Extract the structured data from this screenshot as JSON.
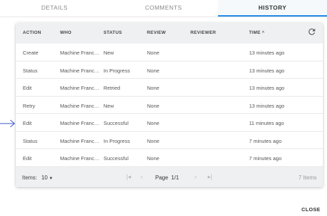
{
  "tabs": [
    {
      "label": "DETAILS",
      "active": false
    },
    {
      "label": "COMMENTS",
      "active": false
    },
    {
      "label": "HISTORY",
      "active": true
    }
  ],
  "table": {
    "columns": [
      "ACTION",
      "WHO",
      "STATUS",
      "REVIEW",
      "REVIEWER",
      "TIME"
    ],
    "sorted_column": "TIME",
    "sort_direction": "ascending",
    "rows": [
      {
        "action": "Create",
        "who": "Machine Francis...",
        "status": "New",
        "review": "None",
        "reviewer": "",
        "time": "13 minutes ago"
      },
      {
        "action": "Status",
        "who": "Machine Francis...",
        "status": "In Progress",
        "review": "None",
        "reviewer": "",
        "time": "13 minutes ago"
      },
      {
        "action": "Edit",
        "who": "Machine Francis...",
        "status": "Retried",
        "review": "None",
        "reviewer": "",
        "time": "13 minutes ago"
      },
      {
        "action": "Retry",
        "who": "Machine Francis...",
        "status": "New",
        "review": "None",
        "reviewer": "",
        "time": "13 minutes ago"
      },
      {
        "action": "Edit",
        "who": "Machine Francis...",
        "status": "Successful",
        "review": "None",
        "reviewer": "",
        "time": "11 minutes ago"
      },
      {
        "action": "Status",
        "who": "Machine Francis...",
        "status": "In Progress",
        "review": "None",
        "reviewer": "",
        "time": "7 minutes ago"
      },
      {
        "action": "Edit",
        "who": "Machine Francis...",
        "status": "Successful",
        "review": "None",
        "reviewer": "",
        "time": "7 minutes ago"
      }
    ]
  },
  "footer": {
    "items_label": "Items:",
    "items_per_page": "10",
    "page_label": "Page",
    "page_value": "1/1",
    "total": "7 Items"
  },
  "close_label": "CLOSE",
  "icons": {
    "refresh": "refresh-icon",
    "first_page": "first-page-icon",
    "prev_page": "chevron-left-icon",
    "next_page": "chevron-right-icon",
    "last_page": "last-page-icon",
    "pointer": "arrow-right-icon"
  },
  "colors": {
    "accent": "#1e88e5",
    "header_bg": "#eef0f2"
  }
}
